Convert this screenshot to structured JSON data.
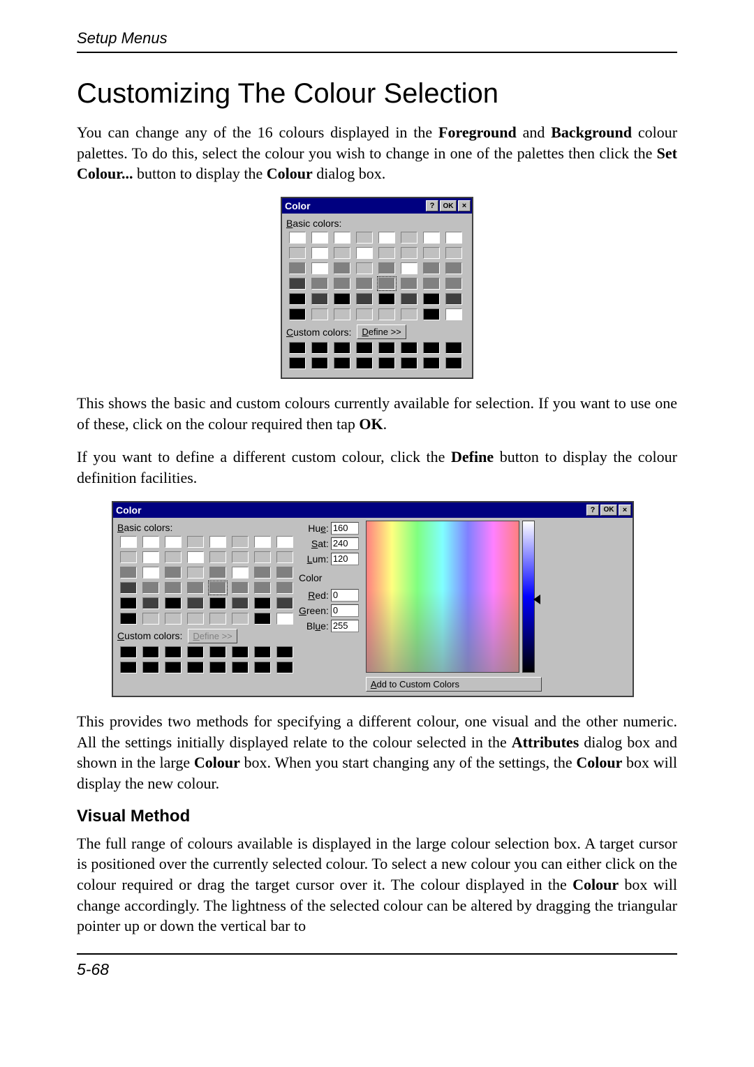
{
  "header": {
    "section": "Setup Menus"
  },
  "title": "Customizing The Colour Selection",
  "para1": {
    "a": "You can change any of the 16 colours displayed in the ",
    "b1": "Foreground",
    "c": " and ",
    "b2": "Background",
    "d": " colour palettes. To do this, select the colour you wish to change in one of the palettes then click the ",
    "b3": "Set Colour...",
    "e": " button to display the ",
    "b4": "Colour",
    "f": " dialog box."
  },
  "para2": {
    "a": "This shows the basic and custom colours currently available for selection. If you want to use one of these, click on the colour required then tap ",
    "b1": "OK",
    "c": "."
  },
  "para3": {
    "a": "If you want to define a different custom colour, click the ",
    "b1": "Define",
    "c": " button to display the colour definition facilities."
  },
  "para4": {
    "a": "This provides two methods for specifying a different colour, one visual and the other numeric. All the settings initially displayed relate to the colour selected in the ",
    "b1": "Attributes",
    "c": " dialog box and shown in the large ",
    "b2": "Colour",
    "d": " box. When you start changing any of the settings, the ",
    "b3": "Colour",
    "e": " box will display the new colour."
  },
  "subhead": "Visual Method",
  "para5": {
    "a": "The full range of colours available is displayed in the large colour selection box. A target cursor is positioned over the currently selected colour. To select a new colour you can either click on the colour required or drag the target cursor over it. The colour displayed in the ",
    "b1": "Colour",
    "c": " box will change accordingly. The lightness of the selected colour can be altered by dragging the triangular pointer up or down the vertical bar to"
  },
  "pagenum": "5-68",
  "dlg": {
    "title": "Color",
    "help": "?",
    "ok": "OK",
    "close": "×",
    "basic_label_u": "B",
    "basic_label_rest": "asic colors:",
    "custom_label_u": "C",
    "custom_label_rest": "ustom colors:",
    "define_u": "D",
    "define_rest": "efine >>",
    "color_label": "Color",
    "hue_label_a": "Hu",
    "hue_label_u": "e",
    "hue_label_b": ":",
    "sat_label_u": "S",
    "sat_label_rest": "at:",
    "lum_label_u": "L",
    "lum_label_rest": "um:",
    "red_label_u": "R",
    "red_label_rest": "ed:",
    "green_label_u": "G",
    "green_label_rest": "reen:",
    "blue_label_a": "Bl",
    "blue_label_u": "u",
    "blue_label_b": "e:",
    "hue_val": "160",
    "sat_val": "240",
    "lum_val": "120",
    "red_val": "0",
    "green_val": "0",
    "blue_val": "255",
    "add_label_u": "A",
    "add_label_rest": "dd to Custom Colors"
  },
  "basic_colors": [
    "#ffffff",
    "#ffffff",
    "#ffffff",
    "#c0c0c0",
    "#ffffff",
    "#c0c0c0",
    "#ffffff",
    "#ffffff",
    "#c0c0c0",
    "#ffffff",
    "#c0c0c0",
    "#ffffff",
    "#c0c0c0",
    "#c0c0c0",
    "#c0c0c0",
    "#c0c0c0",
    "#808080",
    "#ffffff",
    "#808080",
    "#c0c0c0",
    "#808080",
    "#ffffff",
    "#808080",
    "#808080",
    "#404040",
    "#808080",
    "#808080",
    "#808080",
    "#808080",
    "#808080",
    "#808080",
    "#808080",
    "#000000",
    "#404040",
    "#000000",
    "#404040",
    "#000000",
    "#404040",
    "#000000",
    "#404040",
    "#000000",
    "#c0c0c0",
    "#c0c0c0",
    "#c0c0c0",
    "#c0c0c0",
    "#c0c0c0",
    "#000000",
    "#ffffff"
  ],
  "basic_selected_index": 28,
  "custom_colors": [
    "#000000",
    "#000000",
    "#000000",
    "#000000",
    "#000000",
    "#000000",
    "#000000",
    "#000000",
    "#000000",
    "#000000",
    "#000000",
    "#000000",
    "#000000",
    "#000000",
    "#000000",
    "#000000"
  ]
}
